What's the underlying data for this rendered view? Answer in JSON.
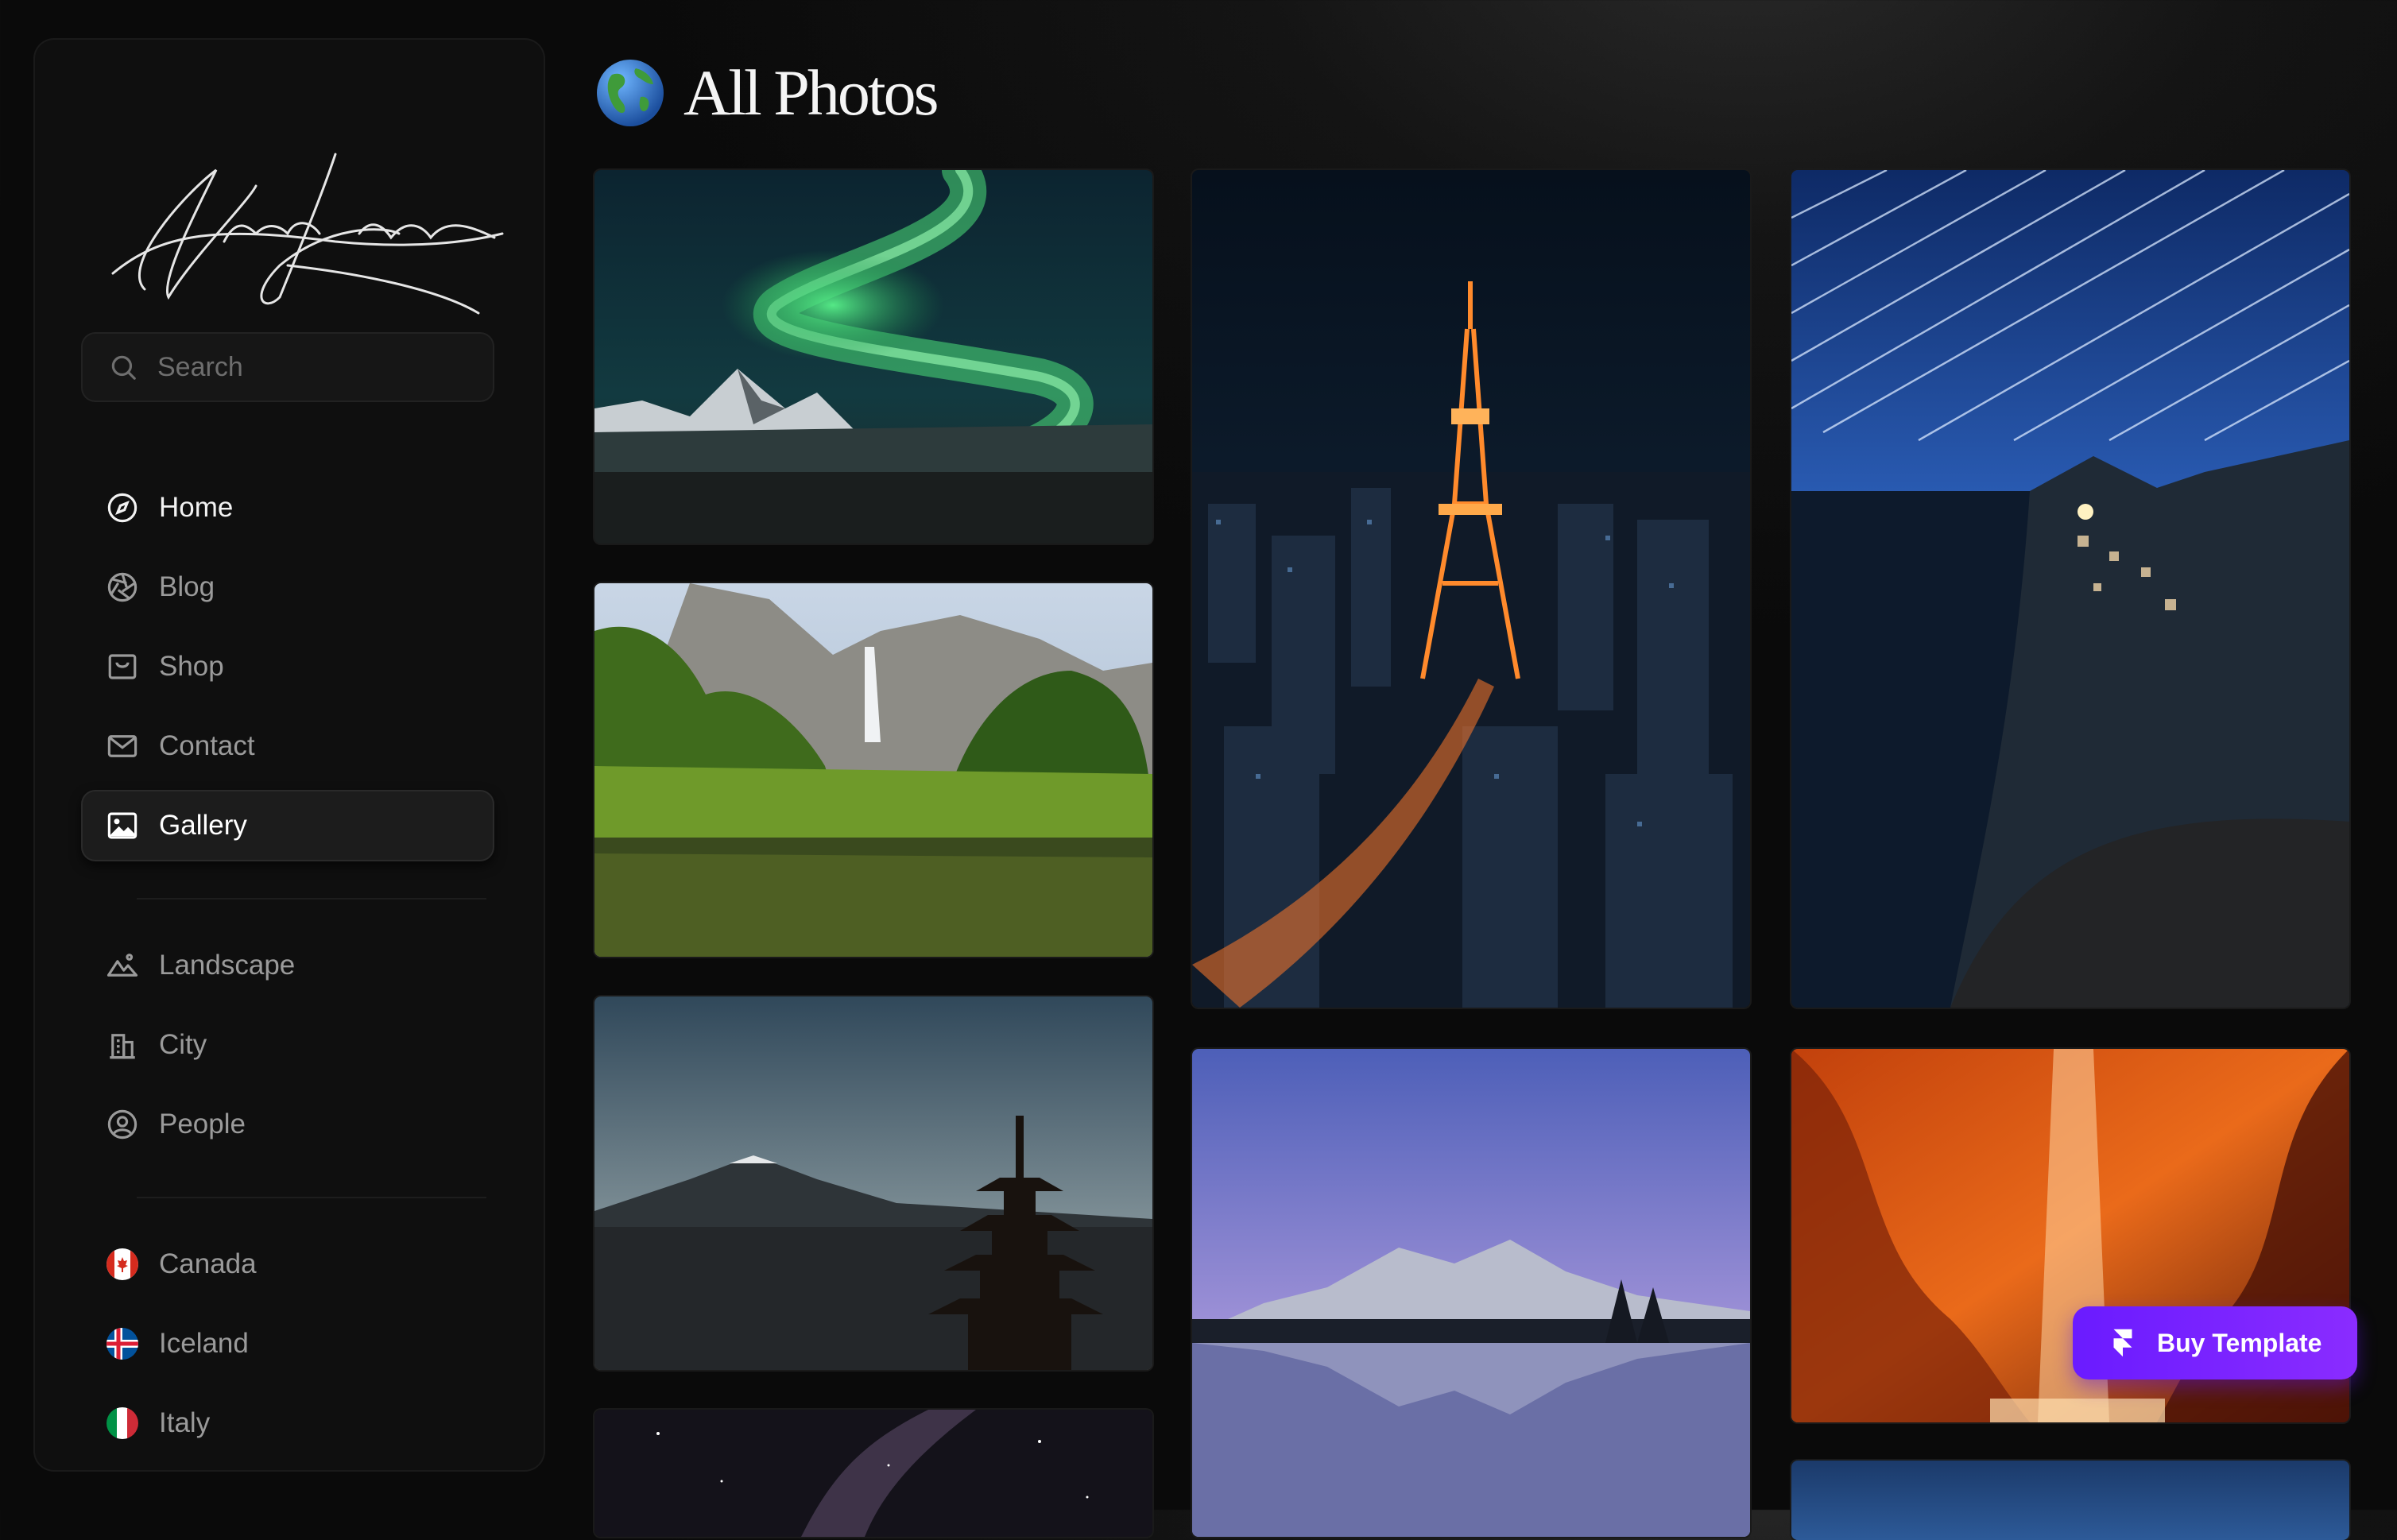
{
  "brand": {
    "signature": "Handwritten signature logo"
  },
  "search": {
    "placeholder": "Search"
  },
  "nav": {
    "primary": [
      {
        "label": "Home",
        "icon": "compass-icon"
      },
      {
        "label": "Blog",
        "icon": "aperture-icon"
      },
      {
        "label": "Shop",
        "icon": "shop-icon"
      },
      {
        "label": "Contact",
        "icon": "mail-icon"
      },
      {
        "label": "Gallery",
        "icon": "image-icon"
      }
    ],
    "categories": [
      {
        "label": "Landscape",
        "icon": "mountains-icon"
      },
      {
        "label": "City",
        "icon": "building-icon"
      },
      {
        "label": "People",
        "icon": "user-circle-icon"
      }
    ],
    "countries": [
      {
        "label": "Canada",
        "icon": "canada-flag-icon"
      },
      {
        "label": "Iceland",
        "icon": "iceland-flag-icon"
      },
      {
        "label": "Italy",
        "icon": "italy-flag-icon"
      }
    ],
    "active": "Gallery"
  },
  "main": {
    "title": "All Photos",
    "title_icon": "globe-icon"
  },
  "cta": {
    "label": "Buy Template",
    "icon": "framer-icon"
  },
  "colors": {
    "accent": "#7b22ff",
    "background": "#0a0a0a",
    "sidebar": "#0f0f0f"
  }
}
